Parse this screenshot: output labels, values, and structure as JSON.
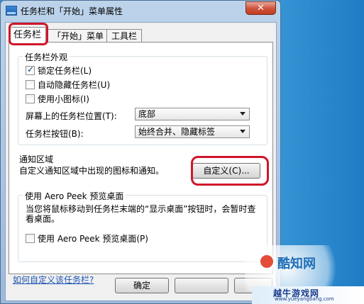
{
  "window": {
    "title": "任务栏和「开始」菜单属性",
    "close_symbol": "✕"
  },
  "tabs": [
    {
      "label": "任务栏",
      "active": true
    },
    {
      "label": "「开始」菜单",
      "active": false
    },
    {
      "label": "工具栏",
      "active": false
    }
  ],
  "appearance": {
    "title": "任务栏外观",
    "lock_taskbar": {
      "label": "锁定任务栏(L)",
      "checked": true
    },
    "auto_hide": {
      "label": "自动隐藏任务栏(U)",
      "checked": false
    },
    "small_icons": {
      "label": "使用小图标(I)",
      "checked": false
    },
    "location_label": "屏幕上的任务栏位置(T):",
    "location_value": "底部",
    "buttons_label": "任务栏按钮(B):",
    "buttons_value": "始终合并、隐藏标签"
  },
  "notification": {
    "title": "通知区域",
    "description": "自定义通知区域中出现的图标和通知。",
    "customize_button": "自定义(C)..."
  },
  "aero_peek": {
    "title": "使用 Aero Peek 预览桌面",
    "description": "当您将鼠标移动到任务栏末端的“显示桌面”按钮时，会暂时查看桌面。",
    "checkbox": {
      "label": "使用 Aero Peek 预览桌面(P)",
      "checked": false
    }
  },
  "help_link": "如何自定义该任务栏?",
  "footer": {
    "ok_button": "确定"
  },
  "watermark": {
    "logo_text": "酷知网",
    "strip_text": "越牛游戏网",
    "strip_url": "www.yueyangbang.com"
  }
}
